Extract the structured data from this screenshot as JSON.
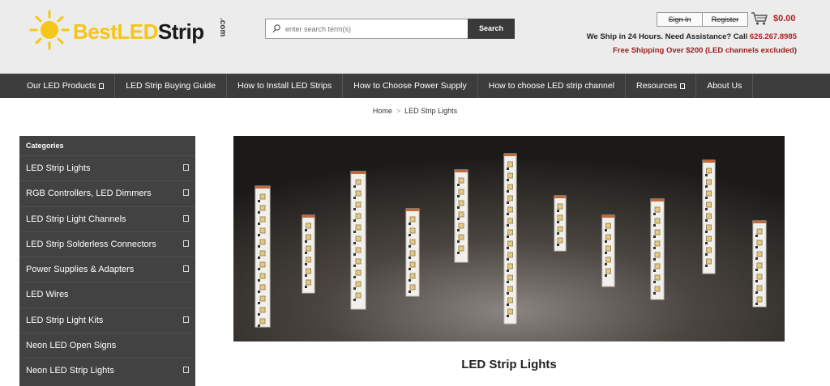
{
  "logo": {
    "text_yellow": "Best",
    "text_yellow2": "LED",
    "text_dark": "Strip",
    "com": ".com"
  },
  "search": {
    "placeholder": "enter search term(s)",
    "button": "Search"
  },
  "account": {
    "sign_in": "Sign In",
    "register": "Register"
  },
  "cart": {
    "total": "$0.00"
  },
  "shipping": {
    "line": "We Ship in 24 Hours. Need Assistance? Call",
    "phone": "626.267.8985",
    "free": "Free Shipping Over $200 (LED channels excluded)"
  },
  "nav": {
    "items": [
      {
        "label": "Our LED Products",
        "dropdown": true
      },
      {
        "label": "LED Strip Buying Guide",
        "dropdown": false
      },
      {
        "label": "How to Install LED Strips",
        "dropdown": false
      },
      {
        "label": "How to Choose Power Supply",
        "dropdown": false
      },
      {
        "label": "How to choose LED strip channel",
        "dropdown": false
      },
      {
        "label": "Resources",
        "dropdown": true
      },
      {
        "label": "About Us",
        "dropdown": false
      }
    ]
  },
  "breadcrumb": {
    "home": "Home",
    "separator": ">",
    "current": "LED Strip Lights"
  },
  "sidebar": {
    "heading": "Categories",
    "items": [
      {
        "label": "LED Strip Lights",
        "expand": true
      },
      {
        "label": "RGB Controllers, LED Dimmers",
        "expand": true
      },
      {
        "label": "LED Strip Light Channels",
        "expand": true
      },
      {
        "label": "LED Strip Solderless Connectors",
        "expand": true
      },
      {
        "label": "Power Supplies & Adapters",
        "expand": true
      },
      {
        "label": "LED Wires",
        "expand": false
      },
      {
        "label": "LED Strip Light Kits",
        "expand": true
      },
      {
        "label": "Neon LED Open Signs",
        "expand": false
      },
      {
        "label": "Neon LED Strip Lights",
        "expand": true
      }
    ]
  },
  "page": {
    "title": "LED Strip Lights"
  },
  "colors": {
    "nav_bg": "#3c3c3c",
    "sidebar_bg": "#424242",
    "accent_red": "#b22222",
    "logo_yellow": "#f5c518"
  }
}
